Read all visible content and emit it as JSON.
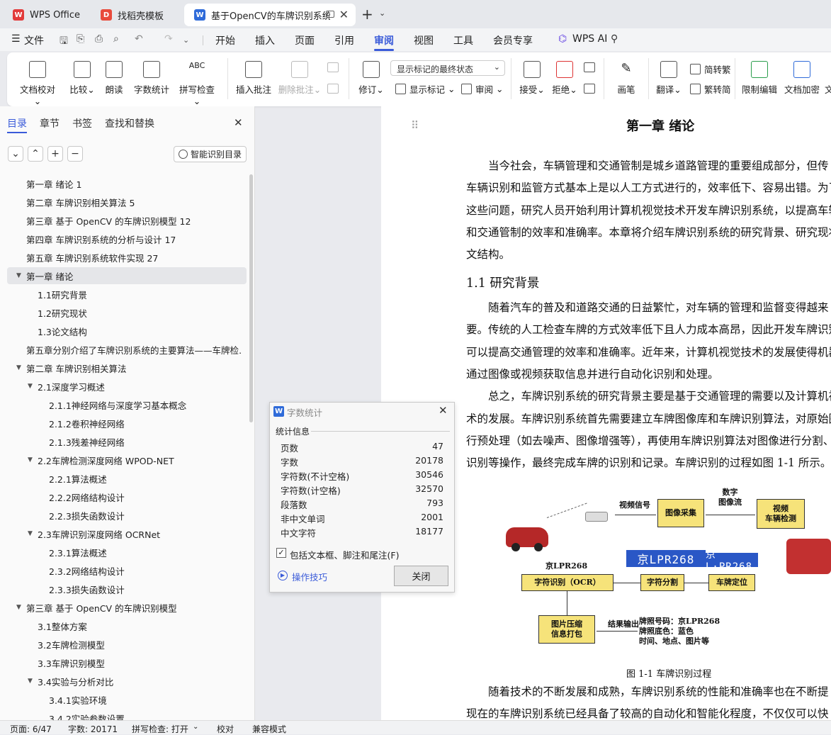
{
  "tabs": [
    {
      "label": "WPS Office",
      "icon": "wps-logo-icon"
    },
    {
      "label": "找稻壳模板",
      "icon": "docer-icon"
    },
    {
      "label": "基于OpenCV的车牌识别系统",
      "icon": "writer-doc-icon"
    }
  ],
  "menu": {
    "file": "文件",
    "items": [
      "开始",
      "插入",
      "页面",
      "引用",
      "审阅",
      "视图",
      "工具",
      "会员专享"
    ],
    "active": "审阅",
    "ai": "WPS AI"
  },
  "ribbon": {
    "proof": "文档校对",
    "compare": "比较",
    "read_aloud": "朗读",
    "word_count": "字数统计",
    "spell_check": "拼写检查",
    "insert_comment": "插入批注",
    "delete_comment": "删除批注",
    "revise": "修订",
    "markup_select": "显示标记的最终状态",
    "show_markup": "显示标记",
    "review": "审阅",
    "accept": "接受",
    "reject": "拒绝",
    "pen": "画笔",
    "translate": "翻译",
    "to_trad": "简转繁",
    "to_simp": "繁转简",
    "restrict_edit": "限制编辑",
    "encrypt": "文档加密",
    "more": "文"
  },
  "panel": {
    "tabs": [
      "目录",
      "章节",
      "书签",
      "查找和替换"
    ],
    "smart_toc": "智能识别目录",
    "toc": [
      {
        "label": "第一章 绪论 1",
        "level": 0,
        "tri": false
      },
      {
        "label": "第二章 车牌识别相关算法 5",
        "level": 0,
        "tri": false
      },
      {
        "label": "第三章 基于 OpenCV 的车牌识别模型  12",
        "level": 0,
        "tri": false
      },
      {
        "label": "第四章 车牌识别系统的分析与设计  17",
        "level": 0,
        "tri": false
      },
      {
        "label": "第五章 车牌识别系统软件实现  27",
        "level": 0,
        "tri": false
      },
      {
        "label": "第一章 绪论",
        "level": 0,
        "tri": true,
        "selected": true
      },
      {
        "label": "1.1研究背景",
        "level": 1,
        "tri": false
      },
      {
        "label": "1.2研究现状",
        "level": 1,
        "tri": false
      },
      {
        "label": "1.3论文结构",
        "level": 1,
        "tri": false
      },
      {
        "label": "第五章分别介绍了车牌识别系统的主要算法——车牌检…",
        "level": 0,
        "tri": false
      },
      {
        "label": "第二章 车牌识别相关算法",
        "level": 0,
        "tri": true
      },
      {
        "label": "2.1深度学习概述",
        "level": 1,
        "tri": true
      },
      {
        "label": "2.1.1神经网络与深度学习基本概念",
        "level": 2,
        "tri": false
      },
      {
        "label": "2.1.2卷积神经网络",
        "level": 2,
        "tri": false
      },
      {
        "label": "2.1.3残差神经网络",
        "level": 2,
        "tri": false
      },
      {
        "label": "2.2车牌检测深度网络 WPOD-NET",
        "level": 1,
        "tri": true
      },
      {
        "label": "2.2.1算法概述",
        "level": 2,
        "tri": false
      },
      {
        "label": "2.2.2网络结构设计",
        "level": 2,
        "tri": false
      },
      {
        "label": "2.2.3损失函数设计",
        "level": 2,
        "tri": false
      },
      {
        "label": "2.3车牌识别深度网络 OCRNet",
        "level": 1,
        "tri": true
      },
      {
        "label": "2.3.1算法概述",
        "level": 2,
        "tri": false
      },
      {
        "label": "2.3.2网络结构设计",
        "level": 2,
        "tri": false
      },
      {
        "label": "2.3.3损失函数设计",
        "level": 2,
        "tri": false
      },
      {
        "label": "第三章 基于 OpenCV 的车牌识别模型",
        "level": 0,
        "tri": true
      },
      {
        "label": "3.1整体方案",
        "level": 1,
        "tri": false
      },
      {
        "label": "3.2车牌检测模型",
        "level": 1,
        "tri": false
      },
      {
        "label": "3.3车牌识别模型",
        "level": 1,
        "tri": false
      },
      {
        "label": "3.4实验与分析对比",
        "level": 1,
        "tri": true
      },
      {
        "label": "3.4.1实验环境",
        "level": 2,
        "tri": false
      },
      {
        "label": "3.4.2实验参数设置",
        "level": 2,
        "tri": false
      }
    ]
  },
  "doc": {
    "chapter": "第一章  绪论",
    "paras1": [
      "　　当今社会，车辆管理和交通管制是城乡道路管理的重要组成部分，但传",
      "车辆识别和监管方式基本上是以人工方式进行的，效率低下、容易出错。为了",
      "这些问题，研究人员开始利用计算机视觉技术开发车牌识别系统，以提高车辆",
      "和交通管制的效率和准确率。本章将介绍车牌识别系统的研究背景、研究现状以",
      "文结构。"
    ],
    "section": "1.1 研究背景",
    "paras2": [
      "　　随着汽车的普及和道路交通的日益繁忙，对车辆的管理和监督变得越来",
      "要。传统的人工检查车牌的方式效率低下且人力成本高昂，因此开发车牌识别",
      "可以提高交通管理的效率和准确率。近年来，计算机视觉技术的发展使得机器",
      "通过图像或视频获取信息并进行自动化识别和处理。",
      "　　总之，车牌识别系统的研究背景主要是基于交通管理的需要以及计算机视",
      "术的发展。车牌识别系统首先需要建立车牌图像库和车牌识别算法，对原始图",
      "行预处理（如去噪声、图像增强等），再使用车牌识别算法对图像进行分割、",
      "识别等操作，最终完成车牌的识别和记录。车牌识别的过程如图 1-1 所示。"
    ],
    "figure": {
      "video_signal": "视频信号",
      "capture": "图像采集",
      "digital_stream": "数字\n图像流",
      "detect": "视频\n车辆检测",
      "plate_text": "京LPR268",
      "plate1": "京LPR268",
      "plate2": "京L·PR268",
      "ocr": "字符识别（OCR）",
      "segment": "字符分割",
      "locate": "车牌定位",
      "compress": "图片压缩\n信息打包",
      "output": "结果输出",
      "result": "牌照号码：京LPR268\n牌照底色：蓝色\n时间、地点、图片等"
    },
    "caption": "图  1-1 车牌识别过程",
    "paras3": [
      "　　随着技术的不断发展和成熟，车牌识别系统的性能和准确率也在不断提",
      "现在的车牌识别系统已经具备了较高的自动化和智能化程度，不仅仅可以快"
    ]
  },
  "dialog": {
    "title": "字数统计",
    "section": "统计信息",
    "rows": [
      {
        "k": "页数",
        "v": "47"
      },
      {
        "k": "字数",
        "v": "20178"
      },
      {
        "k": "字符数(不计空格)",
        "v": "30546"
      },
      {
        "k": "字符数(计空格)",
        "v": "32570"
      },
      {
        "k": "段落数",
        "v": "793"
      },
      {
        "k": "非中文单词",
        "v": "2001"
      },
      {
        "k": "中文字符",
        "v": "18177"
      }
    ],
    "checkbox": "包括文本框、脚注和尾注(F)",
    "tips": "操作技巧",
    "close": "关闭"
  },
  "status": {
    "page": "页面: 6/47",
    "words": "字数: 20171",
    "spell": "拼写检查: 打开",
    "proof": "校对",
    "compat": "兼容模式"
  },
  "colors": {
    "accent": "#3a5bd9",
    "selected_row": "#e5e6e9",
    "plate_blue": "#2a57c6",
    "figure_box": "#f6e37a"
  }
}
